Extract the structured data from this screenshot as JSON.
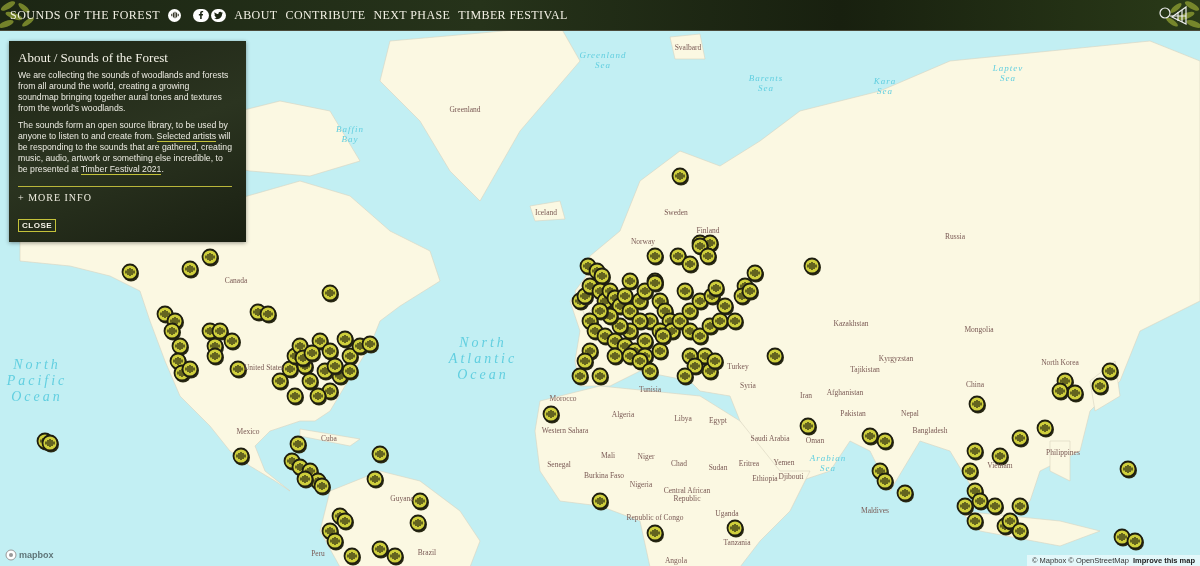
{
  "header": {
    "title": "SOUNDS OF THE FOREST",
    "nav": [
      "ABOUT",
      "CONTRIBUTE",
      "NEXT PHASE",
      "TIMBER FESTIVAL"
    ]
  },
  "about_panel": {
    "title": "About / Sounds of the Forest",
    "paragraph_1": "We are collecting the sounds of woodlands and forests from all around the world, creating a growing soundmap bringing together aural tones and textures from the world’s woodlands.",
    "paragraph_2": [
      {
        "kind": "text",
        "text": "The sounds form an open source library, to be used by anyone to listen to and create from. "
      },
      {
        "kind": "link",
        "text": "Selected artists"
      },
      {
        "kind": "text",
        "text": " will be responding to the sounds that are gathered, creating music, audio, artwork or something else incredible, to be presented at "
      },
      {
        "kind": "link",
        "text": "Timber Festival 2021"
      },
      {
        "kind": "text",
        "text": "."
      }
    ],
    "more_info": "+ MORE INFO",
    "close_button": "CLOSE"
  },
  "map": {
    "labels": [
      {
        "kind": "country",
        "text": "Svalbard"
      },
      {
        "kind": "sea",
        "text": "Greenland Sea"
      },
      {
        "kind": "sea",
        "text": "Laptev Sea"
      },
      {
        "kind": "sea",
        "text": "Barents Sea"
      },
      {
        "kind": "sea",
        "text": "Kara Sea"
      },
      {
        "kind": "country",
        "text": "Greenland"
      },
      {
        "kind": "sea",
        "text": "Baffin Bay"
      },
      {
        "kind": "country",
        "text": "Iceland"
      },
      {
        "kind": "country",
        "text": "Sweden"
      },
      {
        "kind": "country",
        "text": "Finland"
      },
      {
        "kind": "country",
        "text": "Norway"
      },
      {
        "kind": "country",
        "text": "Russia"
      },
      {
        "kind": "country",
        "text": "Canada"
      },
      {
        "kind": "country",
        "text": "Kazakhstan"
      },
      {
        "kind": "country",
        "text": "Mongolia"
      },
      {
        "kind": "ocean",
        "text": "North Atlantic Ocean"
      },
      {
        "kind": "country",
        "text": "Kyrgyzstan"
      },
      {
        "kind": "country",
        "text": "North Korea"
      },
      {
        "kind": "country",
        "text": "United States"
      },
      {
        "kind": "country",
        "text": "Turkey"
      },
      {
        "kind": "country",
        "text": "Tajikistan"
      },
      {
        "kind": "ocean",
        "text": "North Pacific Ocean"
      },
      {
        "kind": "country",
        "text": "Syria"
      },
      {
        "kind": "country",
        "text": "China"
      },
      {
        "kind": "country",
        "text": "Morocco"
      },
      {
        "kind": "country",
        "text": "Tunisia"
      },
      {
        "kind": "country",
        "text": "Iran"
      },
      {
        "kind": "country",
        "text": "Afghanistan"
      },
      {
        "kind": "country",
        "text": "Algeria"
      },
      {
        "kind": "country",
        "text": "Libya"
      },
      {
        "kind": "country",
        "text": "Egypt"
      },
      {
        "kind": "country",
        "text": "Pakistan"
      },
      {
        "kind": "country",
        "text": "Nepal"
      },
      {
        "kind": "country",
        "text": "Mexico"
      },
      {
        "kind": "country",
        "text": "Cuba"
      },
      {
        "kind": "country",
        "text": "Western Sahara"
      },
      {
        "kind": "country",
        "text": "Saudi Arabia"
      },
      {
        "kind": "country",
        "text": "Oman"
      },
      {
        "kind": "country",
        "text": "Bangladesh"
      },
      {
        "kind": "country",
        "text": "Senegal"
      },
      {
        "kind": "country",
        "text": "Mali"
      },
      {
        "kind": "country",
        "text": "Niger"
      },
      {
        "kind": "country",
        "text": "Chad"
      },
      {
        "kind": "country",
        "text": "Sudan"
      },
      {
        "kind": "country",
        "text": "Eritrea"
      },
      {
        "kind": "country",
        "text": "Yemen"
      },
      {
        "kind": "sea",
        "text": "Arabian Sea"
      },
      {
        "kind": "country",
        "text": "Vietnam"
      },
      {
        "kind": "country",
        "text": "Philippines"
      },
      {
        "kind": "country",
        "text": "Burkina Faso"
      },
      {
        "kind": "country",
        "text": "Ethiopia"
      },
      {
        "kind": "country",
        "text": "Djibouti"
      },
      {
        "kind": "country",
        "text": "Guyana"
      },
      {
        "kind": "country",
        "text": "Nigeria"
      },
      {
        "kind": "country",
        "text": "Central African Republic"
      },
      {
        "kind": "country",
        "text": "Republic of Congo"
      },
      {
        "kind": "country",
        "text": "Uganda"
      },
      {
        "kind": "country",
        "text": "Maldives"
      },
      {
        "kind": "country",
        "text": "Peru"
      },
      {
        "kind": "country",
        "text": "Brazil"
      },
      {
        "kind": "country",
        "text": "Tanzania"
      },
      {
        "kind": "country",
        "text": "Angola"
      }
    ]
  },
  "attribution": {
    "logo": "mapbox",
    "credits": "© Mapbox © OpenStreetMap",
    "improve_link": "Improve this map"
  }
}
